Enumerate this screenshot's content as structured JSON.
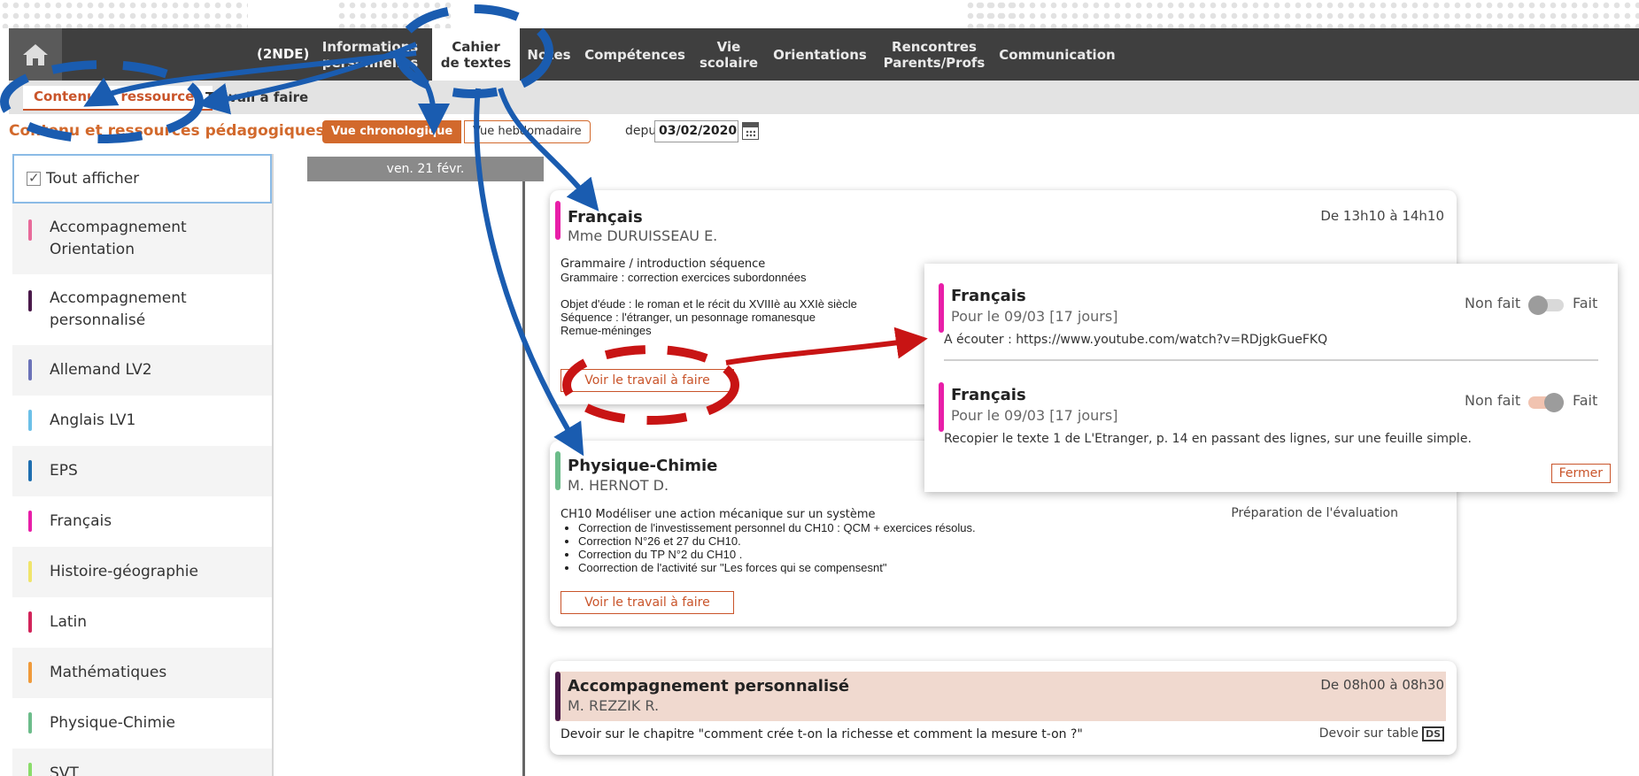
{
  "topnav": {
    "class_label": "(2NDE)",
    "tabs": [
      {
        "id": "infos",
        "line1": "Informations",
        "line2": "personnelles"
      },
      {
        "id": "cahier",
        "line1": "Cahier",
        "line2": "de textes"
      },
      {
        "id": "notes",
        "line1": "Notes",
        "line2": ""
      },
      {
        "id": "competences",
        "line1": "Compétences",
        "line2": ""
      },
      {
        "id": "vie",
        "line1": "Vie",
        "line2": "scolaire"
      },
      {
        "id": "orient",
        "line1": "Orientations",
        "line2": ""
      },
      {
        "id": "rencontres",
        "line1": "Rencontres",
        "line2": "Parents/Profs"
      },
      {
        "id": "comm",
        "line1": "Communication",
        "line2": ""
      }
    ]
  },
  "subtabs": {
    "content": "Contenu et ressources",
    "work": "Travail à faire"
  },
  "toolbar": {
    "section_title": "Contenu et ressources pédagogiques",
    "view_chrono": "Vue chronologique",
    "view_weekly": "Vue hebdomadaire",
    "since_label": "depuis",
    "since_date": "03/02/2020"
  },
  "subjects": {
    "show_all": "Tout afficher",
    "items": [
      {
        "label": "Accompagnement Orientation",
        "color": "#e86a9a"
      },
      {
        "label": "Accompagnement personnalisé",
        "color": "#4a1a4a"
      },
      {
        "label": "Allemand LV2",
        "color": "#6b72b8"
      },
      {
        "label": "Anglais LV1",
        "color": "#6cc0e8"
      },
      {
        "label": "EPS",
        "color": "#1e6eb0"
      },
      {
        "label": "Français",
        "color": "#e81ea8"
      },
      {
        "label": "Histoire-géographie",
        "color": "#f0e46a"
      },
      {
        "label": "Latin",
        "color": "#d2245a"
      },
      {
        "label": "Mathématiques",
        "color": "#f09a3a"
      },
      {
        "label": "Physique-Chimie",
        "color": "#6cbc8a"
      },
      {
        "label": "SVT",
        "color": "#8adc6a"
      }
    ]
  },
  "timeline": {
    "day": "ven. 21 févr."
  },
  "cards": {
    "francais": {
      "title": "Français",
      "teacher": "Mme DURUISSEAU E.",
      "time": "De 13h10 à 14h10",
      "line1": "Grammaire / introduction séquence",
      "line2": "Grammaire : correction exercices subordonnées",
      "line3": "Objet d'éude : le roman et le récit du XVIIIè au XXIè siècle",
      "line4": "Séquence : l'étranger, un pesonnage romanesque",
      "line5": "Remue-méninges",
      "button": "Voir le travail à faire",
      "color": "#e81ea8"
    },
    "physique": {
      "title": "Physique-Chimie",
      "teacher": "M. HERNOT D.",
      "type": "Préparation de l'évaluation",
      "line1": "CH10 Modéliser une action mécanique sur un système",
      "bullets": [
        "Correction de l'investissement personnel du CH10 : QCM + exercices résolus.",
        "Correction N°26 et 27 du CH10.",
        "Correction du TP N°2 du CH10 .",
        "Coorrection de l'activité sur \"Les forces qui se compensesnt\""
      ],
      "button": "Voir le travail à faire",
      "color": "#6cbc8a"
    },
    "accomp": {
      "title": "Accompagnement personnalisé",
      "teacher": "M. REZZIK R.",
      "time": "De 08h00 à 08h30",
      "line1": "Devoir sur le chapitre \"comment crée t-on la richesse et comment la mesure t-on ?\"",
      "type": "Devoir sur table",
      "badge": "DS",
      "color": "#4a1a4a",
      "bg": "#f0d9cf"
    }
  },
  "popup": {
    "item1": {
      "title": "Français",
      "due": "Pour le 09/03 [17 jours]",
      "text": "A écouter : https://www.youtube.com/watch?v=RDjgkGueFKQ",
      "not_done": "Non fait",
      "done": "Fait",
      "done_state": 0
    },
    "item2": {
      "title": "Français",
      "due": "Pour le 09/03 [17 jours]",
      "text": "Recopier le texte 1 de L'Etranger, p. 14 en passant des lignes, sur une feuille simple.",
      "not_done": "Non fait",
      "done": "Fait",
      "done_state": 1
    },
    "close": "Fermer"
  },
  "colors": {
    "accent": "#d2692c",
    "nav_bg": "#3f3f3f",
    "annotation_blue": "#1a5cb0",
    "annotation_red": "#c81414"
  }
}
